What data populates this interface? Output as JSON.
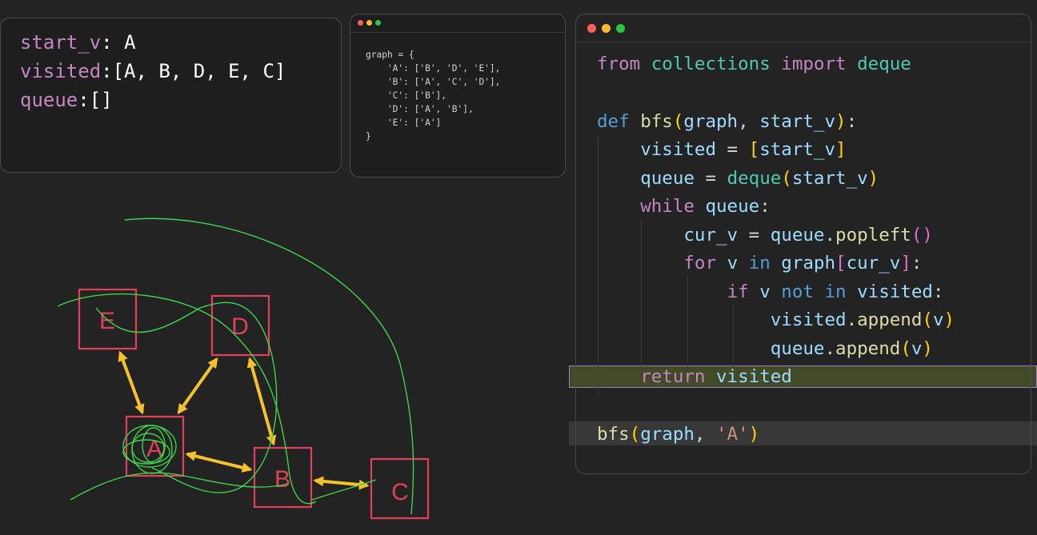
{
  "state_panel": {
    "start_label": "start_v",
    "start_value": "A",
    "visited_label": "visited",
    "visited_value": "[A, B, D, E, C]",
    "queue_label": "queue",
    "queue_value": "[]"
  },
  "graph_dict": {
    "lines": [
      "graph = {",
      "    'A': ['B', 'D', 'E'],",
      "    'B': ['A', 'C', 'D'],",
      "    'C': ['B'],",
      "    'D': ['A', 'B'],",
      "    'E': ['A']",
      "}"
    ]
  },
  "window_dots": [
    "#ff5f57",
    "#febc2e",
    "#28c840"
  ],
  "code": {
    "l1_from": "from",
    "l1_mod": "collections",
    "l1_import": "import",
    "l1_name": "deque",
    "l2_def": "def",
    "l2_fn": "bfs",
    "l2_p1": "graph",
    "l2_p2": "start_v",
    "l3_visited": "visited",
    "l3_arg": "start_v",
    "l4_queue": "queue",
    "l4_fn": "deque",
    "l4_arg": "start_v",
    "l5_while": "while",
    "l5_queue": "queue",
    "l6_var": "cur_v",
    "l6_obj": "queue",
    "l6_fn": "popleft",
    "l7_for": "for",
    "l7_v": "v",
    "l7_in": "in",
    "l7_graph": "graph",
    "l7_idx": "cur_v",
    "l8_if": "if",
    "l8_v": "v",
    "l8_not": "not",
    "l8_in": "in",
    "l8_visited": "visited",
    "l9_obj": "visited",
    "l9_fn": "append",
    "l9_arg": "v",
    "l10_obj": "queue",
    "l10_fn": "append",
    "l10_arg": "v",
    "l11_return": "return",
    "l11_visited": "visited",
    "l12_fn": "bfs",
    "l12_arg1": "graph",
    "l12_arg2": "'A'"
  },
  "diagram": {
    "nodes": [
      {
        "id": "E",
        "label": "E"
      },
      {
        "id": "D",
        "label": "D"
      },
      {
        "id": "A",
        "label": "A"
      },
      {
        "id": "B",
        "label": "B"
      },
      {
        "id": "C",
        "label": "C"
      }
    ],
    "edges": [
      [
        "E",
        "A"
      ],
      [
        "A",
        "D"
      ],
      [
        "D",
        "B"
      ],
      [
        "A",
        "B"
      ],
      [
        "B",
        "C"
      ]
    ],
    "node_color": "#e0405a",
    "edge_color": "#f5c227",
    "annotation_color": "#3fd34a"
  }
}
